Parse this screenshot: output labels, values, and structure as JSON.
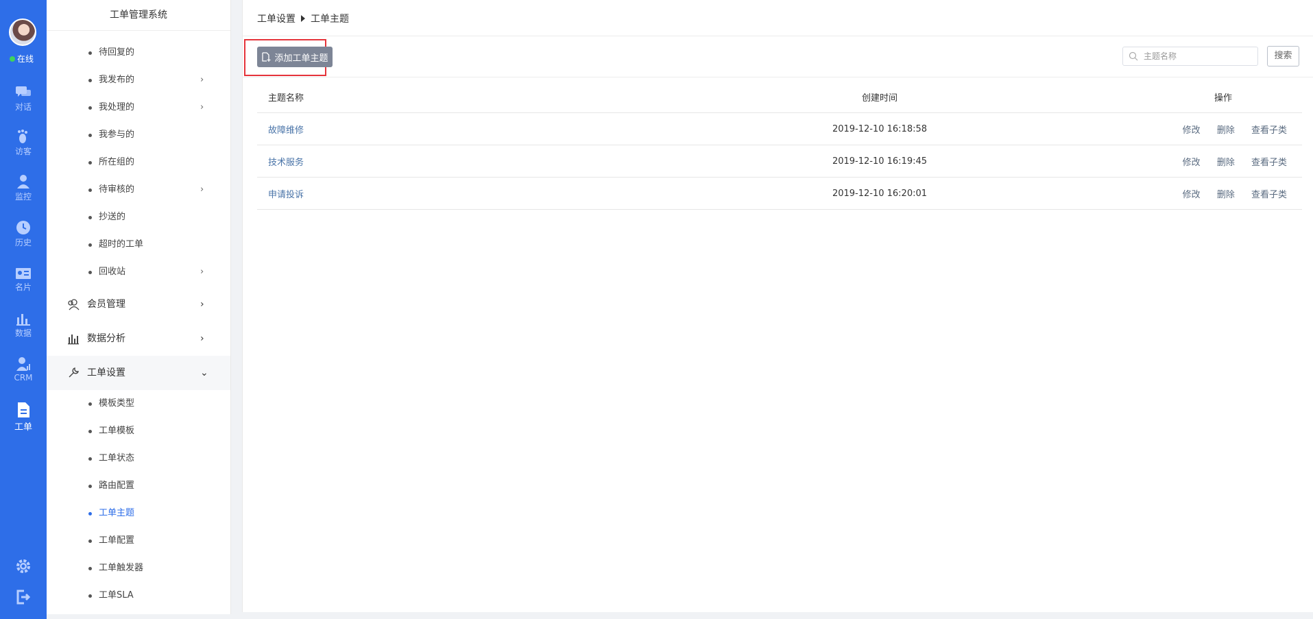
{
  "rail": {
    "status": "在线",
    "items": [
      {
        "label": "对话",
        "icon": "chat-icon"
      },
      {
        "label": "访客",
        "icon": "footprint-icon"
      },
      {
        "label": "监控",
        "icon": "monitor-user-icon"
      },
      {
        "label": "历史",
        "icon": "clock-icon"
      },
      {
        "label": "名片",
        "icon": "card-icon"
      },
      {
        "label": "数据",
        "icon": "bar-chart-icon"
      },
      {
        "label": "CRM",
        "icon": "crm-icon"
      },
      {
        "label": "工单",
        "icon": "document-icon"
      }
    ],
    "bottom_icons": [
      "gear-icon",
      "logout-icon"
    ]
  },
  "nav": {
    "title": "工单管理系统",
    "sub_items": [
      {
        "label": "待回复的"
      },
      {
        "label": "我发布的"
      },
      {
        "label": "我处理的"
      },
      {
        "label": "我参与的"
      },
      {
        "label": "所在组的"
      },
      {
        "label": "待审核的"
      },
      {
        "label": "抄送的"
      },
      {
        "label": "超时的工单"
      },
      {
        "label": "回收站"
      }
    ],
    "groups": [
      {
        "label": "会员管理",
        "icon": "members-icon"
      },
      {
        "label": "数据分析",
        "icon": "analysis-icon"
      },
      {
        "label": "工单设置",
        "icon": "wrench-icon"
      }
    ],
    "settings_items": [
      {
        "label": "模板类型"
      },
      {
        "label": "工单模板"
      },
      {
        "label": "工单状态"
      },
      {
        "label": "路由配置"
      },
      {
        "label": "工单主题"
      },
      {
        "label": "工单配置"
      },
      {
        "label": "工单触发器"
      },
      {
        "label": "工单SLA"
      }
    ]
  },
  "breadcrumb": {
    "parent": "工单设置",
    "current": "工单主题"
  },
  "toolbar": {
    "add_label": "添加工单主题",
    "search_placeholder": "主题名称",
    "search_button": "搜索"
  },
  "table": {
    "headers": {
      "name": "主题名称",
      "time": "创建时间",
      "ops": "操作"
    },
    "rows": [
      {
        "name": "故障维修",
        "time": "2019-12-10 16:18:58"
      },
      {
        "name": "技术服务",
        "time": "2019-12-10 16:19:45"
      },
      {
        "name": "申请投诉",
        "time": "2019-12-10 16:20:01"
      }
    ],
    "ops": {
      "edit": "修改",
      "delete": "删除",
      "view_sub": "查看子类"
    }
  },
  "colors": {
    "rail_bg": "#2e6ee8",
    "highlight": "#e5333a",
    "add_button": "#7d8596"
  }
}
